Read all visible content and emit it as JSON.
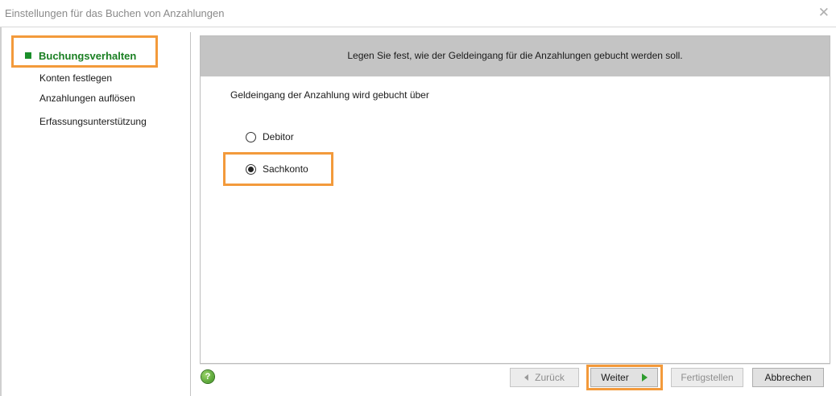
{
  "window": {
    "title": "Einstellungen für das Buchen von Anzahlungen",
    "close_icon": "close-icon"
  },
  "sidebar": {
    "items": [
      {
        "label": "Buchungsverhalten",
        "active": true
      },
      {
        "label": "Konten festlegen",
        "active": false
      },
      {
        "label": "Anzahlungen auflösen",
        "active": false
      },
      {
        "label": "Erfassungsunterstützung",
        "active": false
      }
    ]
  },
  "main": {
    "banner": "Legen Sie fest, wie der Geldeingang für die Anzahlungen gebucht werden soll.",
    "question": "Geldeingang der Anzahlung wird gebucht über",
    "options": [
      {
        "label": "Debitor",
        "checked": false
      },
      {
        "label": "Sachkonto",
        "checked": true
      }
    ]
  },
  "footer": {
    "help_icon": "help-icon",
    "back_label": "Zurück",
    "next_label": "Weiter",
    "finish_label": "Fertigstellen",
    "cancel_label": "Abbrechen"
  },
  "colors": {
    "highlight": "#f39a3b",
    "active_nav": "#1a7f22",
    "banner_bg": "#c4c4c4"
  }
}
